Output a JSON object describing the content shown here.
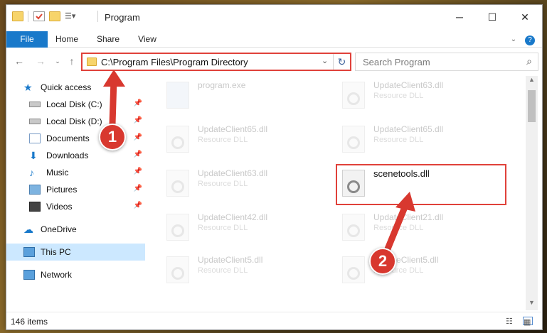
{
  "window": {
    "title": "Program"
  },
  "ribbon": {
    "tabs": [
      "File",
      "Home",
      "Share",
      "View"
    ]
  },
  "address": {
    "path": "C:\\Program Files\\Program Directory"
  },
  "search": {
    "placeholder": "Search Program"
  },
  "sidebar": {
    "items": [
      {
        "label": "Quick access"
      },
      {
        "label": "Local Disk (C:)"
      },
      {
        "label": "Local Disk (D:)"
      },
      {
        "label": "Documents"
      },
      {
        "label": "Downloads"
      },
      {
        "label": "Music"
      },
      {
        "label": "Pictures"
      },
      {
        "label": "Videos"
      },
      {
        "label": "OneDrive"
      },
      {
        "label": "This PC"
      },
      {
        "label": "Network"
      }
    ]
  },
  "files": [
    {
      "name": "program.exe",
      "type": ""
    },
    {
      "name": "UpdateClient63.dll",
      "type": "Resource DLL"
    },
    {
      "name": "UpdateClient65.dll",
      "type": "Resource DLL"
    },
    {
      "name": "UpdateClient65.dll",
      "type": "Resource DLL"
    },
    {
      "name": "UpdateClient63.dll",
      "type": "Resource DLL"
    },
    {
      "name": "scenetools.dll",
      "type": ""
    },
    {
      "name": "UpdateClient42.dll",
      "type": "Resource DLL"
    },
    {
      "name": "UpdateClient21.dll",
      "type": "Resource DLL"
    },
    {
      "name": "UpdateClient5.dll",
      "type": "Resource DLL"
    },
    {
      "name": "UpdateClient5.dll",
      "type": "Resource DLL"
    }
  ],
  "status": {
    "count": "146 items"
  },
  "annotations": {
    "step1": "1",
    "step2": "2"
  },
  "colors": {
    "accent": "#1979ca",
    "highlight": "#e0413a",
    "selected": "#cce8ff"
  }
}
